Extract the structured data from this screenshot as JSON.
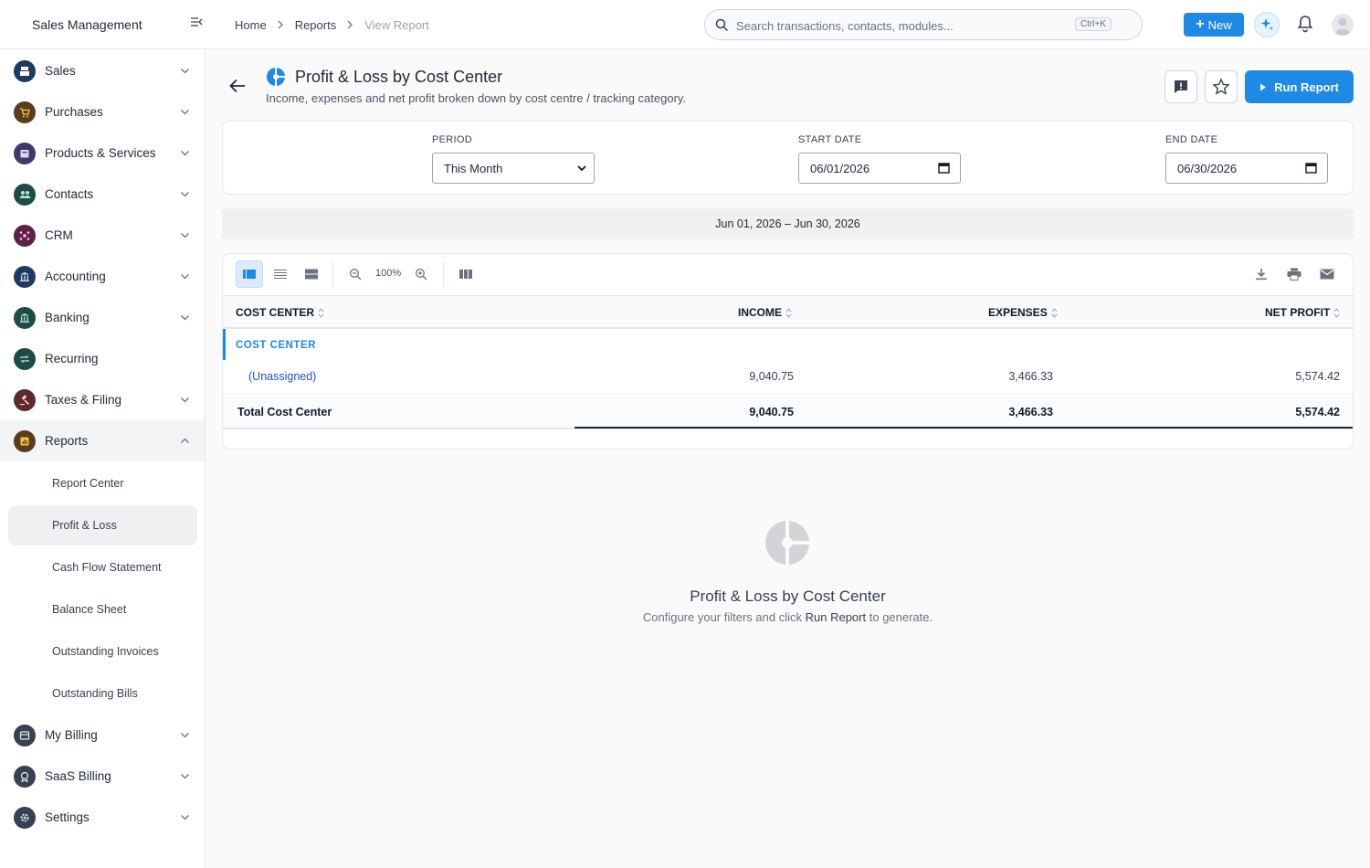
{
  "app": {
    "title": "Sales Management"
  },
  "breadcrumb": [
    "Home",
    "Reports",
    "View Report"
  ],
  "search": {
    "placeholder": "Search transactions, contacts, modules...",
    "shortcut": "Ctrl+K"
  },
  "header": {
    "new_label": "New"
  },
  "sidebar": {
    "items": [
      {
        "label": "Sales",
        "icon": "register-icon",
        "color": "#1e3a5f"
      },
      {
        "label": "Purchases",
        "icon": "cart-icon",
        "color": "#5a3e1b"
      },
      {
        "label": "Products & Services",
        "icon": "box-icon",
        "color": "#3f3a6b"
      },
      {
        "label": "Contacts",
        "icon": "people-icon",
        "color": "#1f4a45"
      },
      {
        "label": "CRM",
        "icon": "network-icon",
        "color": "#5b2146"
      },
      {
        "label": "Accounting",
        "icon": "bank-icon",
        "color": "#1e3a5f"
      },
      {
        "label": "Banking",
        "icon": "bank-icon",
        "color": "#1f4a45"
      },
      {
        "label": "Recurring",
        "icon": "repeat-icon",
        "color": "#1f4a45"
      },
      {
        "label": "Taxes & Filing",
        "icon": "gavel-icon",
        "color": "#5b2a2a"
      },
      {
        "label": "Reports",
        "icon": "report-icon",
        "color": "#5a3e1b"
      },
      {
        "label": "My Billing",
        "icon": "billing-icon",
        "color": "#374151"
      },
      {
        "label": "SaaS Billing",
        "icon": "badge-icon",
        "color": "#374151"
      },
      {
        "label": "Settings",
        "icon": "gear-icon",
        "color": "#374151"
      }
    ],
    "reports_sub": [
      "Report Center",
      "Profit & Loss",
      "Cash Flow Statement",
      "Balance Sheet",
      "Outstanding Invoices",
      "Outstanding Bills"
    ]
  },
  "page": {
    "title": "Profit & Loss by Cost Center",
    "subtitle": "Income, expenses and net profit broken down by cost centre / tracking category.",
    "run_label": "Run Report"
  },
  "filters": {
    "period_label": "PERIOD",
    "period_value": "This Month",
    "start_label": "START DATE",
    "start_value": "06/01/2026",
    "end_label": "END DATE",
    "end_value": "06/30/2026"
  },
  "period_range": "Jun 01, 2026 – Jun 30, 2026",
  "toolbar": {
    "zoom": "100%"
  },
  "table": {
    "headers": [
      "COST CENTER",
      "INCOME",
      "EXPENSES",
      "NET PROFIT"
    ],
    "group": "COST CENTER",
    "rows": [
      {
        "name": "(Unassigned)",
        "income": "9,040.75",
        "expenses": "3,466.33",
        "net": "5,574.42"
      }
    ],
    "total": {
      "name": "Total Cost Center",
      "income": "9,040.75",
      "expenses": "3,466.33",
      "net": "5,574.42"
    }
  },
  "empty_state": {
    "title": "Profit & Loss by Cost Center",
    "sub_prefix": "Configure your filters and click",
    "sub_action": "Run Report",
    "sub_suffix": "to generate."
  },
  "colors": {
    "accent": "#1f8ae6"
  }
}
